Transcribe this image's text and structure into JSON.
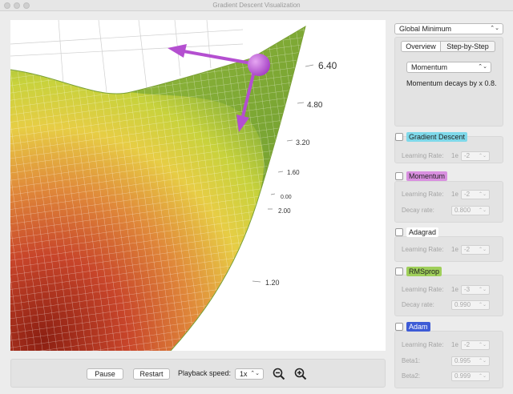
{
  "window": {
    "title": "Gradient Descent Visualization"
  },
  "plot": {
    "axis_ticks": [
      "6.40",
      "4.80",
      "3.20",
      "1.60",
      "0.00",
      "2.00",
      "1.20"
    ]
  },
  "controls": {
    "pause_label": "Pause",
    "restart_label": "Restart",
    "speed_label": "Playback speed:",
    "speed_value": "1x"
  },
  "sidebar": {
    "surface_select": "Global Minimum",
    "tabs": [
      {
        "label": "Overview",
        "active": true
      },
      {
        "label": "Step-by-Step",
        "active": false
      }
    ],
    "explain_select": "Momentum",
    "explain_text": "Momentum decays by x 0.8.",
    "algorithms": [
      {
        "name": "Gradient Descent",
        "color": "#7fd9ea",
        "checked": false,
        "params": [
          {
            "label": "Learning Rate:",
            "prefix": "1e",
            "value": "-2",
            "stepper": true
          }
        ]
      },
      {
        "name": "Momentum",
        "color": "#d98fe0",
        "checked": false,
        "params": [
          {
            "label": "Learning Rate:",
            "prefix": "1e",
            "value": "-2",
            "stepper": true
          },
          {
            "label": "Decay rate:",
            "prefix": "",
            "value": "0.800",
            "stepper": true
          }
        ]
      },
      {
        "name": "Adagrad",
        "color": "#ffffff",
        "checked": false,
        "params": [
          {
            "label": "Learning Rate:",
            "prefix": "1e",
            "value": "-2",
            "stepper": true
          }
        ]
      },
      {
        "name": "RMSprop",
        "color": "#9fcf5a",
        "checked": false,
        "params": [
          {
            "label": "Learning Rate:",
            "prefix": "1e",
            "value": "-3",
            "stepper": true
          },
          {
            "label": "Decay rate:",
            "prefix": "",
            "value": "0.990",
            "stepper": true
          }
        ]
      },
      {
        "name": "Adam",
        "color": "#3d5bd6",
        "text_color": "#ffffff",
        "checked": false,
        "params": [
          {
            "label": "Learning Rate:",
            "prefix": "1e",
            "value": "-2",
            "stepper": true
          },
          {
            "label": "Beta1:",
            "prefix": "",
            "value": "0.995",
            "stepper": true
          },
          {
            "label": "Beta2:",
            "prefix": "",
            "value": "0.999",
            "stepper": true
          }
        ]
      }
    ]
  }
}
